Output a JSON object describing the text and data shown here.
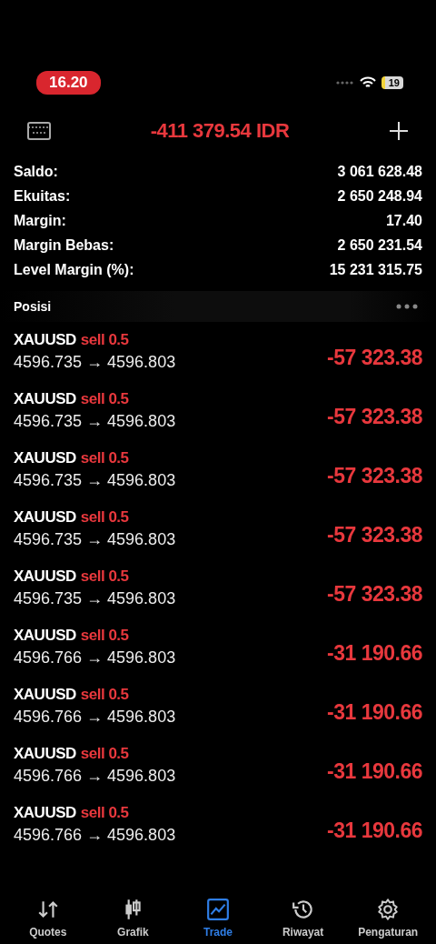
{
  "status_bar": {
    "time": "16.20",
    "battery": "19"
  },
  "header": {
    "balance": "-411 379.54 IDR"
  },
  "summary": [
    {
      "label": "Saldo:",
      "value": "3 061 628.48"
    },
    {
      "label": "Ekuitas:",
      "value": "2 650 248.94"
    },
    {
      "label": "Margin:",
      "value": "17.40"
    },
    {
      "label": "Margin Bebas:",
      "value": "2 650 231.54"
    },
    {
      "label": "Level Margin (%):",
      "value": "15 231 315.75"
    }
  ],
  "positions_title": "Posisi",
  "positions": [
    {
      "symbol": "XAUUSD",
      "side": "sell 0.5",
      "prices": "4596.735 → 4596.803",
      "profit": "-57 323.38"
    },
    {
      "symbol": "XAUUSD",
      "side": "sell 0.5",
      "prices": "4596.735 → 4596.803",
      "profit": "-57 323.38"
    },
    {
      "symbol": "XAUUSD",
      "side": "sell 0.5",
      "prices": "4596.735 → 4596.803",
      "profit": "-57 323.38"
    },
    {
      "symbol": "XAUUSD",
      "side": "sell 0.5",
      "prices": "4596.735 → 4596.803",
      "profit": "-57 323.38"
    },
    {
      "symbol": "XAUUSD",
      "side": "sell 0.5",
      "prices": "4596.735 → 4596.803",
      "profit": "-57 323.38"
    },
    {
      "symbol": "XAUUSD",
      "side": "sell 0.5",
      "prices": "4596.766 → 4596.803",
      "profit": "-31 190.66"
    },
    {
      "symbol": "XAUUSD",
      "side": "sell 0.5",
      "prices": "4596.766 → 4596.803",
      "profit": "-31 190.66"
    },
    {
      "symbol": "XAUUSD",
      "side": "sell 0.5",
      "prices": "4596.766 → 4596.803",
      "profit": "-31 190.66"
    },
    {
      "symbol": "XAUUSD",
      "side": "sell 0.5",
      "prices": "4596.766 → 4596.803",
      "profit": "-31 190.66"
    }
  ],
  "tabs": [
    {
      "label": "Quotes",
      "kind": "quotes",
      "selected": false
    },
    {
      "label": "Grafik",
      "kind": "chart",
      "selected": false
    },
    {
      "label": "Trade",
      "kind": "trade",
      "selected": true
    },
    {
      "label": "Riwayat",
      "kind": "history",
      "selected": false
    },
    {
      "label": "Pengaturan",
      "kind": "settings",
      "selected": false
    }
  ]
}
